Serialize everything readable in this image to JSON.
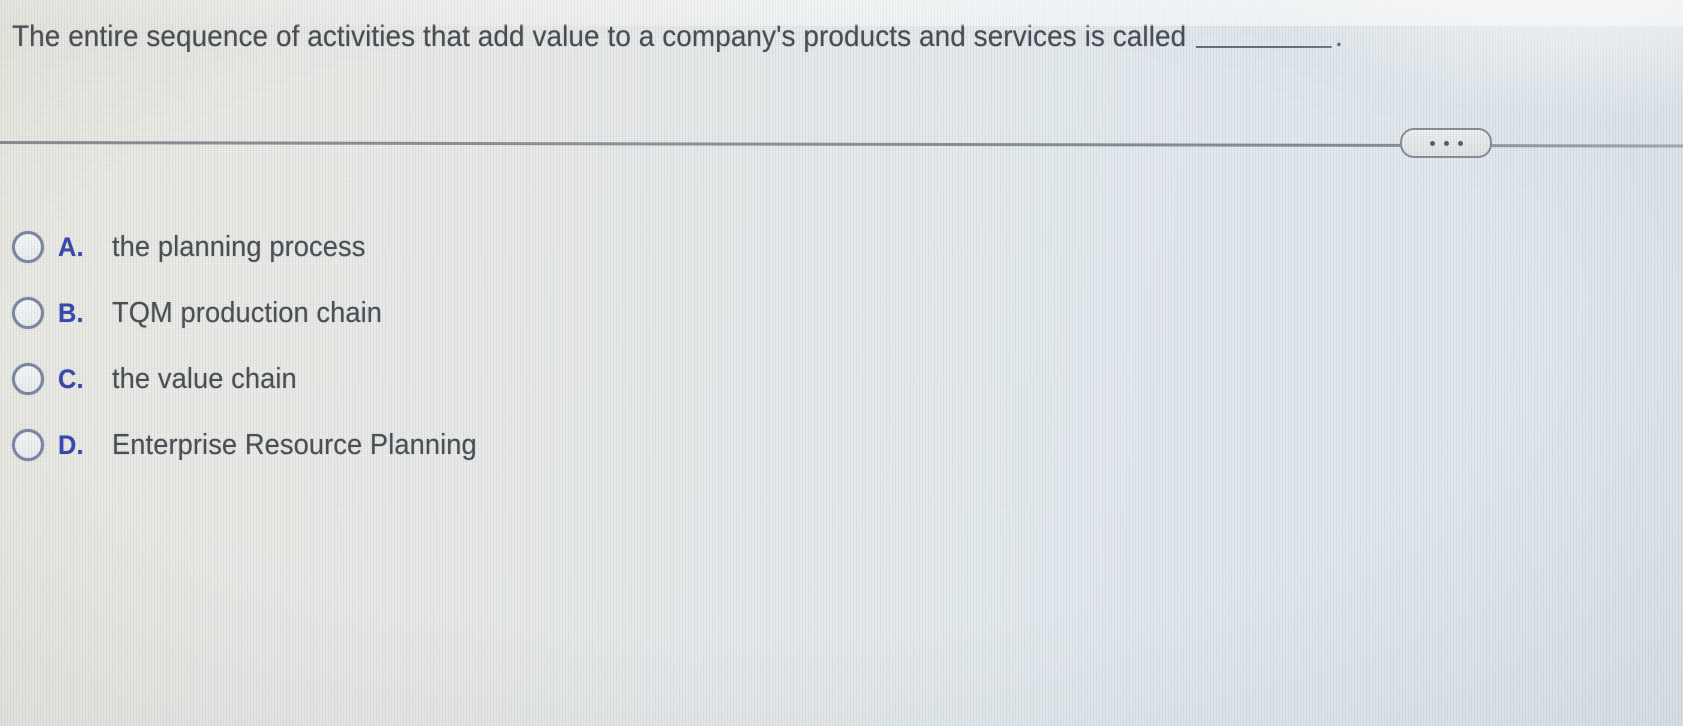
{
  "question": {
    "text_before_blank": "The entire sequence of activities that add value to a company's products and services is called",
    "blank": "__________",
    "text_after_blank": "."
  },
  "toolbar": {
    "more_options_label": "...",
    "more_options_name": "ellipsis-menu"
  },
  "options": [
    {
      "letter": "A.",
      "text": "the planning process",
      "selected": false
    },
    {
      "letter": "B.",
      "text": "TQM production chain",
      "selected": false
    },
    {
      "letter": "C.",
      "text": "the value chain",
      "selected": false
    },
    {
      "letter": "D.",
      "text": "Enterprise Resource Planning",
      "selected": false
    }
  ],
  "colors": {
    "option_letter": "#3a4ab0",
    "body_text": "#4c5158",
    "radio_ring": "#8089a8",
    "divider": "#7c838a",
    "background_left": "#eeece4",
    "background_right": "#e4ebf1"
  }
}
